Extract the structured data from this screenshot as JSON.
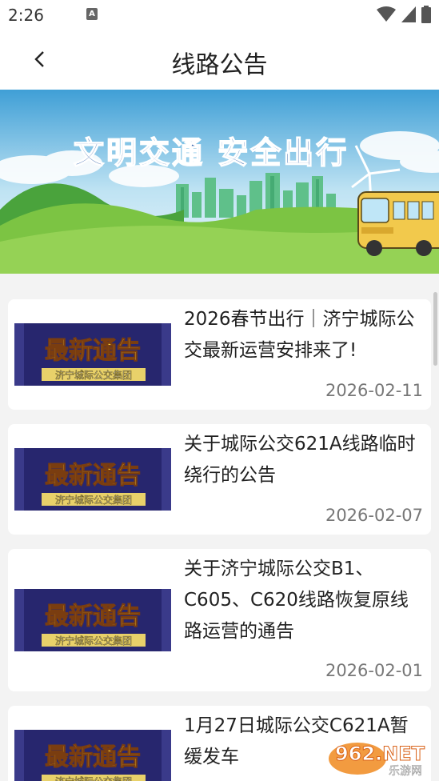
{
  "status": {
    "time": "2:26",
    "notification_glyph": "A"
  },
  "header": {
    "title": "线路公告",
    "back_icon": "chevron-left-icon"
  },
  "banner": {
    "slogan": "文明交通  安全出行"
  },
  "thumbnail": {
    "title": "最新通告",
    "subtitle": "济宁城际公交集团"
  },
  "notices": [
    {
      "title": "2026春节出行｜济宁城际公交最新运营安排来了!",
      "date": "2026-02-11"
    },
    {
      "title": "关于城际公交621A线路临时绕行的公告",
      "date": "2026-02-07"
    },
    {
      "title": "关于济宁城际公交B1、C605、C620线路恢复原线路运营的通告",
      "date": "2026-02-01"
    },
    {
      "title": "1月27日城际公交C621A暂缓发车",
      "date": ""
    }
  ],
  "watermark": {
    "brand": "962.NET",
    "site": "乐游网"
  },
  "colors": {
    "header_bg": "#ffffff",
    "list_bg": "#f3f3f3",
    "thumb_bg": "#27266e",
    "thumb_title": "#f2cf3a",
    "date": "#777777"
  }
}
